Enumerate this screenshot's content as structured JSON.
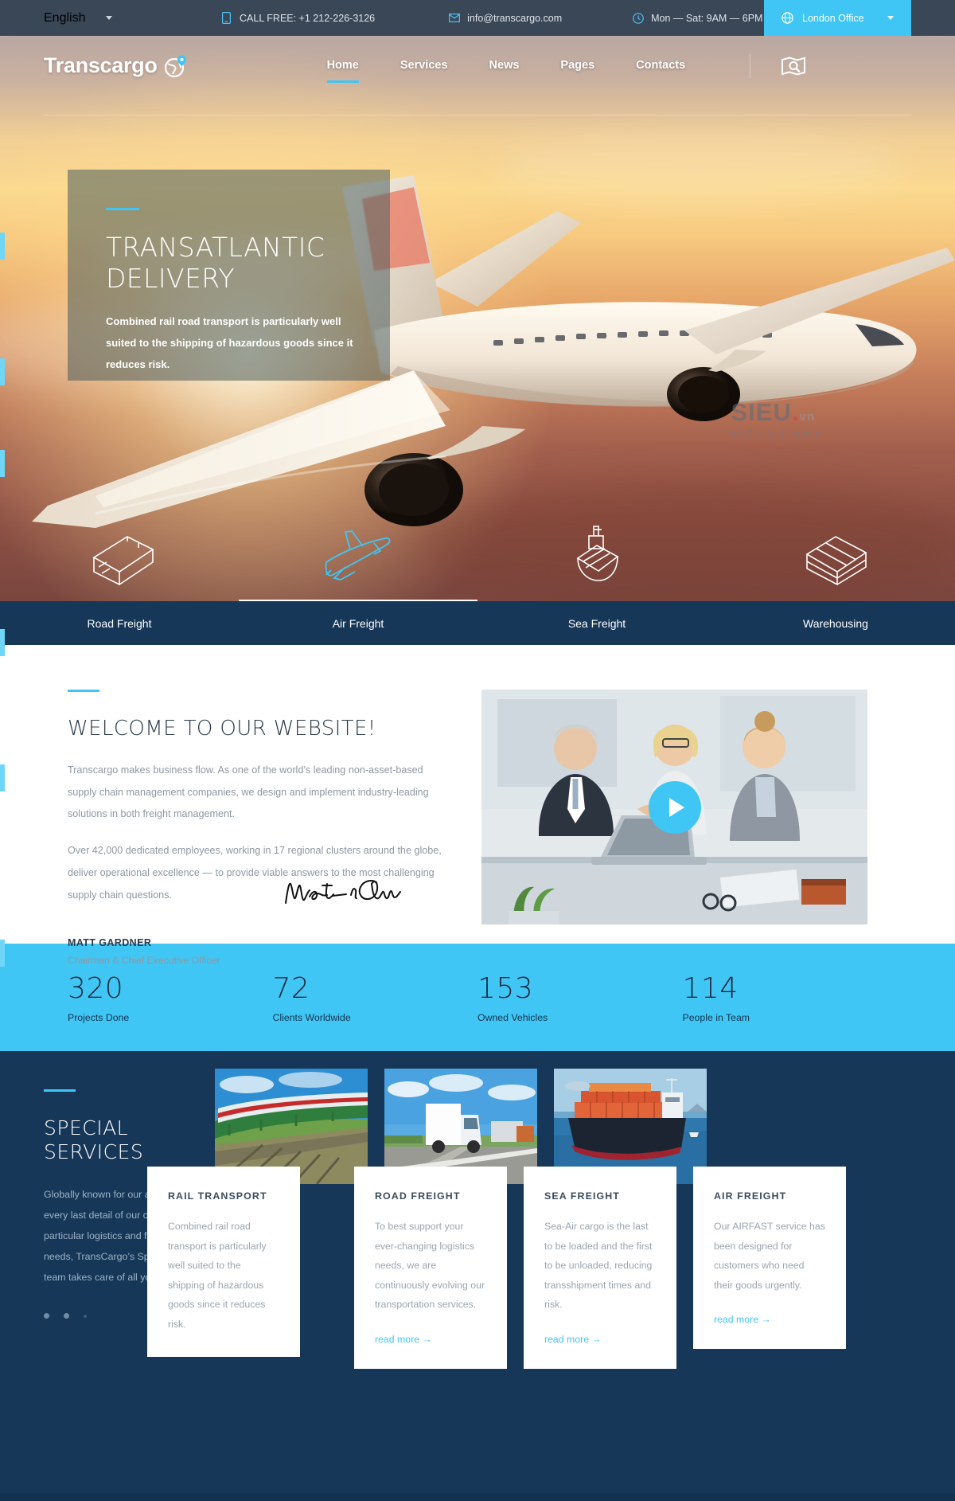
{
  "topbar": {
    "language": "English",
    "phone_label": "CALL FREE: +1 212-226-3126",
    "email": "info@transcargo.com",
    "hours": "Mon — Sat: 9AM — 6PM",
    "office": "London Office",
    "icons": {
      "phone": "mobile-phone-icon",
      "mail": "envelope-icon",
      "clock": "clock-icon",
      "globe": "globe-icon",
      "caret": "chevron-down-icon"
    }
  },
  "nav": {
    "brand": "Transcargo",
    "items": [
      {
        "label": "Home",
        "active": true
      },
      {
        "label": "Services",
        "active": false
      },
      {
        "label": "News",
        "active": false
      },
      {
        "label": "Pages",
        "active": false
      },
      {
        "label": "Contacts",
        "active": false
      }
    ],
    "map_icon": "map-search-icon"
  },
  "hero": {
    "title_line1": "TRANSATLANTIC",
    "title_line2": "DELIVERY",
    "subtitle": "Combined rail road transport is particularly well suited to the shipping of hazardous goods since it reduces risk.",
    "watermark_top": "SIEU",
    "watermark_dot": ".",
    "watermark_vn": "vn",
    "watermark_bottom": "THIẾT KẾ WEB"
  },
  "service_tabs": [
    {
      "label": "Road Freight",
      "icon": "truck-icon",
      "active": false
    },
    {
      "label": "Air Freight",
      "icon": "airplane-icon",
      "active": true
    },
    {
      "label": "Sea Freight",
      "icon": "ship-icon",
      "active": false
    },
    {
      "label": "Warehousing",
      "icon": "warehouse-icon",
      "active": false
    }
  ],
  "welcome": {
    "title": "WELCOME TO OUR WEBSITE!",
    "paragraph1": "Transcargo makes business flow. As one of the world’s leading non-asset-based supply chain management companies, we design and implement industry-leading solutions in both freight management.",
    "paragraph2": "Over 42,000 dedicated employees, working in 17 regional clusters around the globe, deliver operational excellence — to provide viable answers to the most challenging supply chain questions.",
    "person_name": "MATT GARDNER",
    "person_role": "Chairman & Chief Executive Officer",
    "signature_text": "Martin Gardner",
    "video_play_icon": "play-button-icon"
  },
  "counters": [
    {
      "value": "320",
      "label": "Projects Done"
    },
    {
      "value": "72",
      "label": "Clients Worldwide"
    },
    {
      "value": "153",
      "label": "Owned Vehicles"
    },
    {
      "value": "114",
      "label": "People in Team"
    }
  ],
  "special": {
    "title_line1": "SPECIAL",
    "title_line2": "SERVICES",
    "paragraph": "Globally known for our ability to handle every last detail of our customers’ particular logistics and forwarding needs, TransCargo’s Special Services team takes care of all your logistics.",
    "cards": [
      {
        "title": "RAIL TRANSPORT",
        "title_visible": "NSPORT",
        "text": "Combined rail road transport is particularly well suited to the shipping of hazardous goods since it reduces risk.",
        "text_visible": "transport is ted to the us goods .",
        "read_more": "read more",
        "image": "freight-train-image",
        "clipped": "left"
      },
      {
        "title": "ROAD FREIGHT",
        "text": "To best support your ever-changing logistics needs, we are continuously evolving our transportation services.",
        "read_more": "read more",
        "image": "cargo-truck-image",
        "clipped": "none"
      },
      {
        "title": "SEA FREIGHT",
        "text": "Sea-Air cargo is the last to be loaded and the first to be unloaded, reducing transshipment times and risk.",
        "read_more": "read more",
        "image": "container-ship-image",
        "clipped": "none"
      },
      {
        "title": "AIR FREIGHT",
        "text": "Our AIRFAST service has been designed for customers who need their goods urgently.",
        "text_visible": "Our AIRFAST service been designed for c who need their goo urgently.",
        "read_more": "read more",
        "image": "",
        "clipped": "right"
      }
    ],
    "arrow": "→"
  },
  "colors": {
    "accent": "#3fc6f5",
    "dark_blue": "#163758",
    "topbar": "#3a4757",
    "text_muted": "#9aa4ae"
  }
}
